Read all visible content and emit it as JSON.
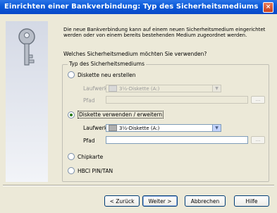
{
  "window": {
    "title": "Einrichten einer Bankverbindung: Typ des Sicherheitsmediums",
    "close_glyph": "×"
  },
  "intro_text": "Die neue Bankverbindung kann auf einem neuen Sicherheitsmedium eingerichtet werden oder von einem bereits bestehenden Medium zugeordnet werden.",
  "question": "Welches Sicherheitsmedium möchten Sie verwenden?",
  "group": {
    "legend": "Typ des Sicherheitsmediums",
    "options": [
      {
        "label": "Diskette neu erstellen",
        "checked": false
      },
      {
        "label": "Diskette verwenden / erweitern",
        "checked": true
      },
      {
        "label": "Chipkarte",
        "checked": false
      },
      {
        "label": "HBCI PIN/TAN",
        "checked": false
      }
    ],
    "new_disk": {
      "drive_label": "Laufwerk",
      "drive_value": "3½-Diskette (A:)",
      "path_label": "Pfad",
      "path_value": "",
      "browse_label": "..."
    },
    "use_disk": {
      "drive_label": "Laufwerk",
      "drive_value": "3½-Diskette (A:)",
      "path_label": "Pfad",
      "path_value": "",
      "browse_label": "..."
    }
  },
  "buttons": {
    "back": "< Zurück",
    "next": "Weiter >",
    "cancel": "Abbrechen",
    "help": "Hilfe"
  },
  "icons": {
    "key": "key-icon",
    "drive": "floppy-drive-icon",
    "dropdown": "chevron-down-icon"
  },
  "colors": {
    "titlebar": "#0a5ad8",
    "dialog_bg": "#ece9d8",
    "radio_checked": "#2a7a1a"
  }
}
